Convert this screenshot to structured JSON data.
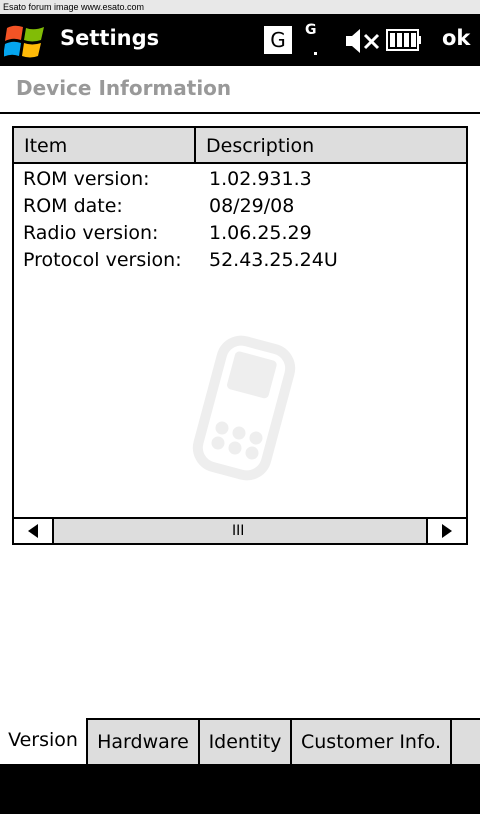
{
  "banner": {
    "text": "Esato forum image www.esato.com"
  },
  "titlebar": {
    "title": "Settings",
    "indicator_g": "G",
    "indicator_g2": "G",
    "ok_label": "ok"
  },
  "page": {
    "header": "Device Information"
  },
  "list": {
    "columns": [
      "Item",
      "Description"
    ],
    "rows": [
      {
        "item": "ROM version:",
        "desc": "1.02.931.3"
      },
      {
        "item": "ROM date:",
        "desc": "08/29/08"
      },
      {
        "item": "Radio version:",
        "desc": "1.06.25.29"
      },
      {
        "item": "Protocol version:",
        "desc": "52.43.25.24U"
      }
    ],
    "scroll_thumb": "III"
  },
  "tabs": [
    {
      "label": "Version",
      "active": true
    },
    {
      "label": "Hardware",
      "active": false
    },
    {
      "label": "Identity",
      "active": false
    },
    {
      "label": "Customer Info.",
      "active": false
    }
  ]
}
